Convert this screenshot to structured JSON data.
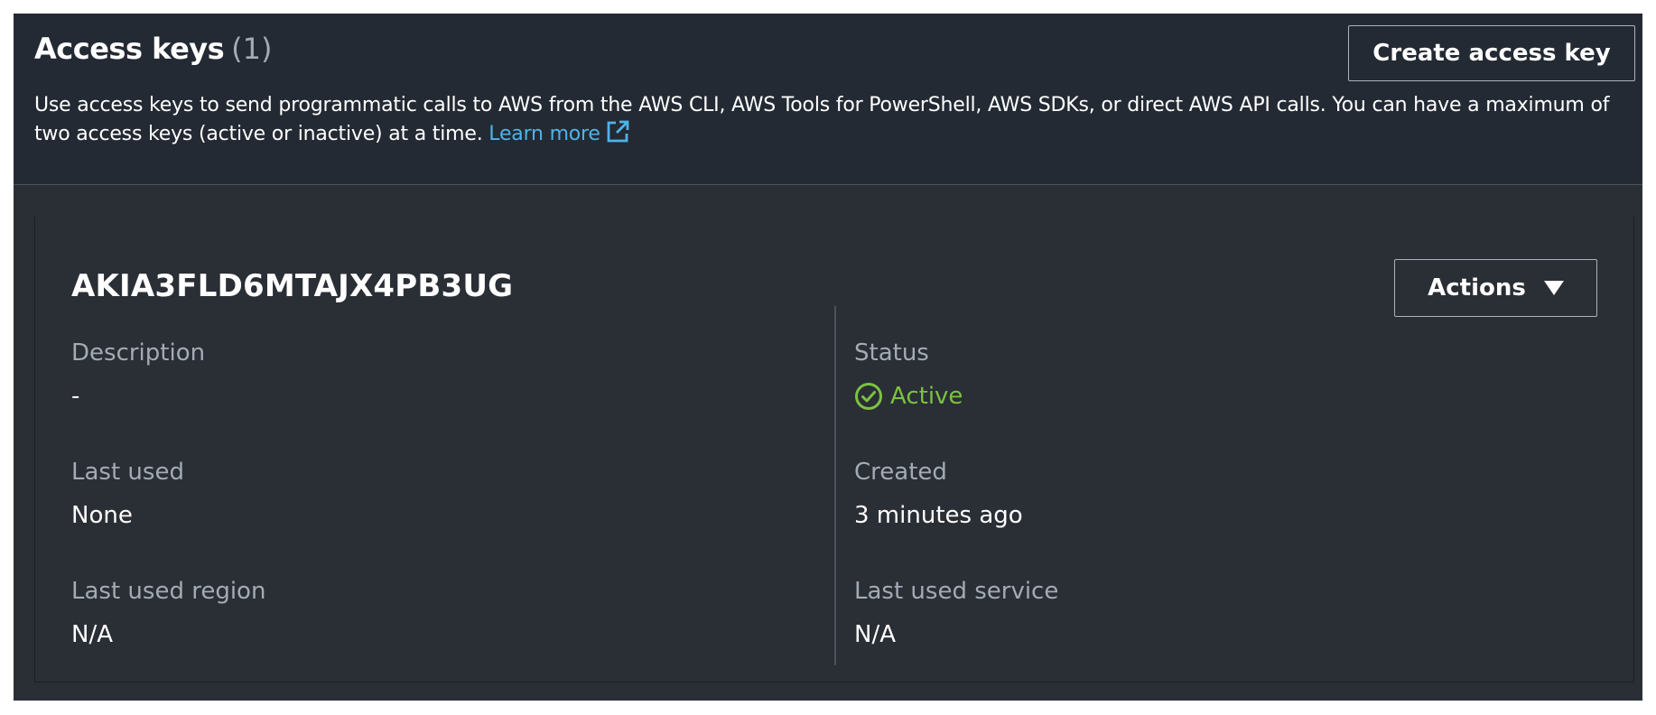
{
  "header": {
    "title": "Access keys",
    "count": "(1)",
    "create_label": "Create access key",
    "description": "Use access keys to send programmatic calls to AWS from the AWS CLI, AWS Tools for PowerShell, AWS SDKs, or direct AWS API calls. You can have a maximum of two access keys (active or inactive) at a time.",
    "learn_more": "Learn more"
  },
  "key": {
    "id": "AKIA3FLD6MTAJX4PB3UG",
    "actions_label": "Actions",
    "fields": {
      "description": {
        "label": "Description",
        "value": "-"
      },
      "status": {
        "label": "Status",
        "value": "Active"
      },
      "last_used": {
        "label": "Last used",
        "value": "None"
      },
      "created": {
        "label": "Created",
        "value": "3 minutes ago"
      },
      "last_used_region": {
        "label": "Last used region",
        "value": "N/A"
      },
      "last_used_service": {
        "label": "Last used service",
        "value": "N/A"
      }
    }
  },
  "colors": {
    "accent_link": "#4fb3e8",
    "status_active": "#7cc242"
  },
  "icons": {
    "external_link": "external-link-icon",
    "status": "check-circle-icon",
    "actions": "caret-down-icon"
  }
}
